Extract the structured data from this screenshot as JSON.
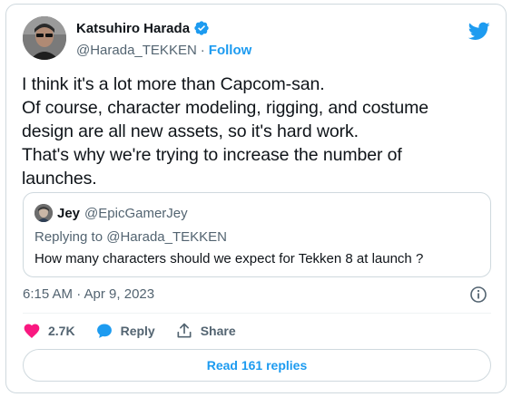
{
  "author": {
    "name": "Katsuhiro Harada",
    "handle": "@Harada_TEKKEN",
    "separator": "·",
    "follow_label": "Follow"
  },
  "tweet": {
    "lines": [
      "I think it's a lot more than Capcom-san.",
      "Of course, character modeling, rigging, and costume",
      "design are all new assets, so it's hard work.",
      "That's why we're trying to increase the number of",
      "launches."
    ]
  },
  "quoted": {
    "name": "Jey",
    "handle": "@EpicGamerJey",
    "replying_to": "Replying to @Harada_TEKKEN",
    "text": "How many characters should we expect for Tekken 8 at launch ?"
  },
  "timestamp": "6:15 AM · Apr 9, 2023",
  "actions": {
    "likes": "2.7K",
    "reply_label": "Reply",
    "share_label": "Share"
  },
  "read_replies_label": "Read 161 replies",
  "colors": {
    "accent": "#1d9bf0",
    "like": "#f91880",
    "text": "#0f1419",
    "muted": "#536471",
    "border": "#cfd9de"
  },
  "icons": [
    "verified-badge-icon",
    "twitter-bird-icon",
    "info-icon",
    "heart-icon",
    "reply-bubble-icon",
    "share-icon"
  ]
}
